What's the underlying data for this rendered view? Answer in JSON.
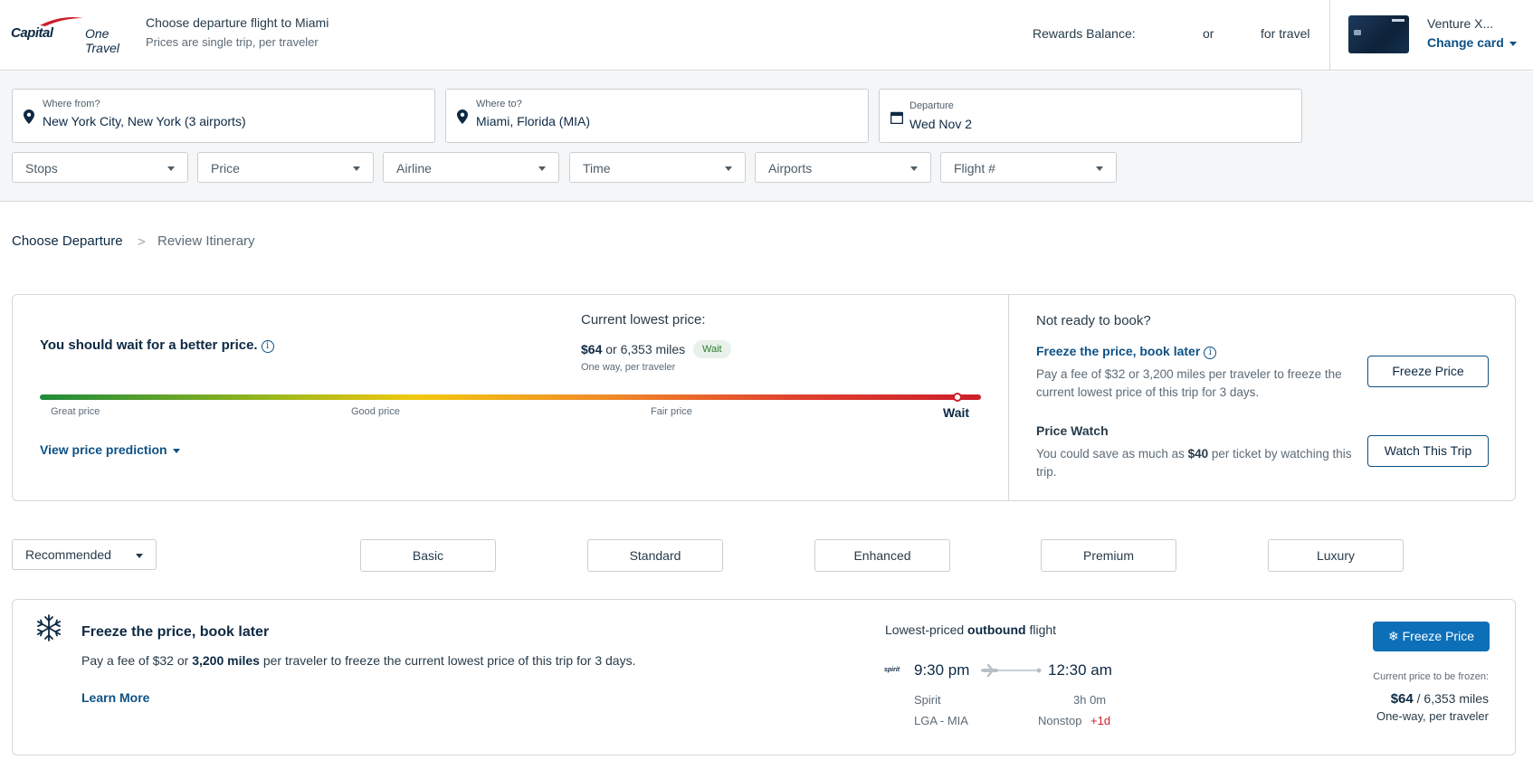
{
  "header": {
    "logo_brand": "Capital",
    "logo_suffix": "One Travel",
    "title": "Choose departure flight to Miami",
    "subtitle": "Prices are single trip, per traveler",
    "rewards_label": "Rewards Balance:",
    "rewards_or": "or",
    "rewards_travel": "for travel",
    "card_name": "Venture X...",
    "change_card": "Change card"
  },
  "search": {
    "from_label": "Where from?",
    "from_value": "New York City, New York (3 airports)",
    "to_label": "Where to?",
    "to_value": "Miami, Florida (MIA)",
    "date_label": "Departure",
    "date_value": "Wed Nov 2"
  },
  "filters": [
    "Stops",
    "Price",
    "Airline",
    "Time",
    "Airports",
    "Flight #"
  ],
  "breadcrumb": {
    "step1": "Choose Departure",
    "separator": ">",
    "step2": "Review Itinerary"
  },
  "prediction": {
    "message": "You should wait for a better price.",
    "current_label": "Current lowest price:",
    "price": "$64",
    "or": "or",
    "miles": "6,353 miles",
    "badge": "Wait",
    "sub": "One way, per traveler",
    "scale": {
      "great": "Great price",
      "good": "Good price",
      "fair": "Fair price",
      "wait": "Wait"
    },
    "view_prediction": "View price prediction"
  },
  "not_ready": {
    "title": "Not ready to book?",
    "freeze_title": "Freeze the price, book later",
    "freeze_desc": "Pay a fee of $32 or 3,200 miles per traveler to freeze the current lowest price of this trip for 3 days.",
    "freeze_button": "Freeze Price",
    "watch_title": "Price Watch",
    "watch_desc_pre": "You could save as much as ",
    "watch_amount": "$40",
    "watch_desc_post": " per ticket by watching this trip.",
    "watch_button": "Watch This Trip"
  },
  "sort": {
    "selected": "Recommended"
  },
  "fare_tabs": [
    "Basic",
    "Standard",
    "Enhanced",
    "Premium",
    "Luxury"
  ],
  "freeze_banner": {
    "title": "Freeze the price, book later",
    "desc_pre": "Pay a fee of $32 or ",
    "desc_miles": "3,200 miles",
    "desc_post": " per traveler to freeze the current lowest price of this trip for 3 days.",
    "learn_more": "Learn More",
    "lowest_pre": "Lowest-priced ",
    "lowest_bold": "outbound",
    "lowest_post": " flight",
    "airline_logo": "spirit",
    "depart_time": "9:30 pm",
    "arrive_time": "12:30 am",
    "carrier": "Spirit",
    "duration": "3h 0m",
    "route": "LGA - MIA",
    "stops": "Nonstop",
    "plus_day": "+1d",
    "button": "Freeze Price",
    "price_label": "Current price to be frozen:",
    "price": "$64",
    "price_sep": " / ",
    "price_miles": "6,353 miles",
    "price_sub": "One-way, per traveler"
  },
  "colors": {
    "brand_navy": "#0d2943",
    "link_blue": "#0d5185",
    "primary_button": "#0d6fb8",
    "alert_red": "#cc1f2a"
  }
}
